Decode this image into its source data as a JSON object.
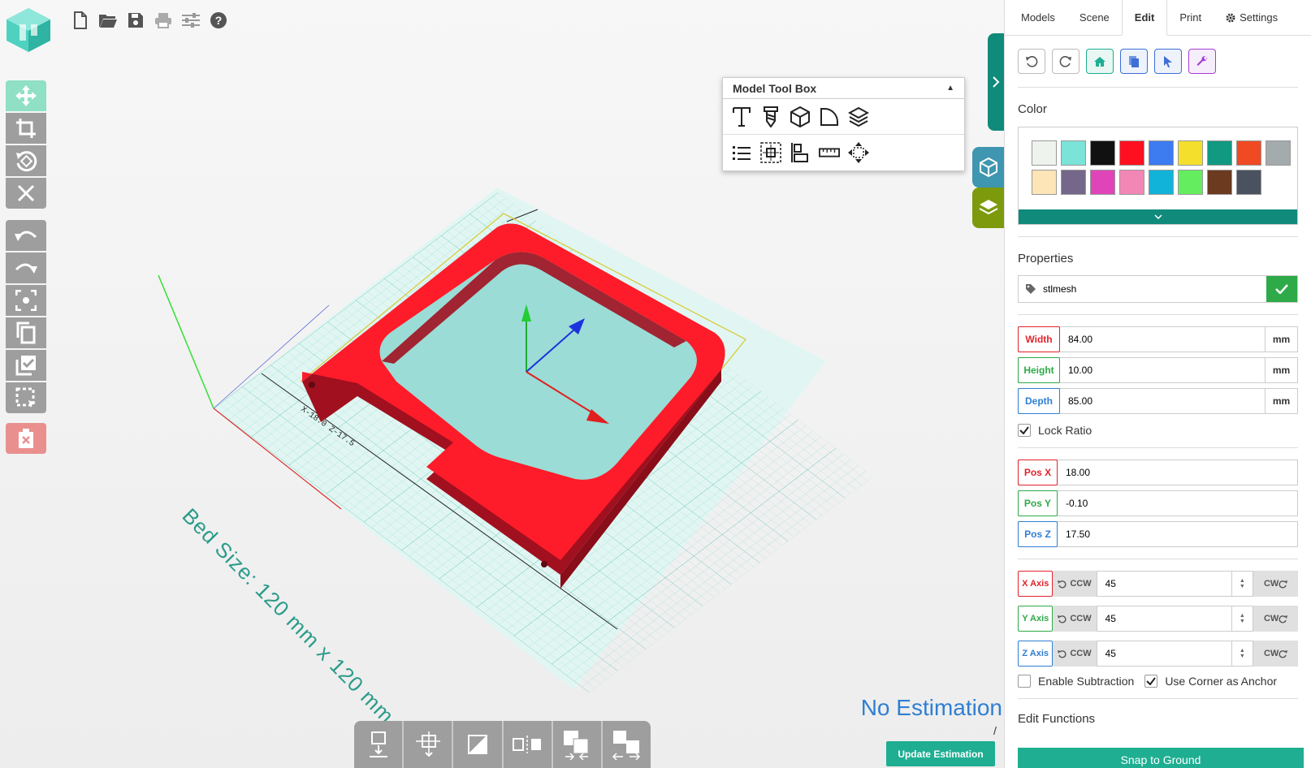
{
  "app": {
    "name": "3D printing slicer"
  },
  "topbar": {
    "items": [
      "new-file-icon",
      "open-folder-icon",
      "save-icon",
      "print-icon",
      "sliders-icon",
      "help-icon"
    ]
  },
  "viewport": {
    "bed_label": "Bed Size: 120 mm x 120 mm",
    "coord_label": "X-18.0 Z-17.5",
    "no_estimation": "No Estimation",
    "slash": "/",
    "update_button": "Update Estimation"
  },
  "toolbox": {
    "title": "Model Tool Box"
  },
  "tabs": {
    "models": "Models",
    "scene": "Scene",
    "edit": "Edit",
    "print": "Print",
    "settings": "Settings"
  },
  "color": {
    "label": "Color",
    "swatches": [
      "#eef3ee",
      "#7be3d8",
      "#111111",
      "#ff1020",
      "#3d7bf0",
      "#f4df2c",
      "#119981",
      "#ef4a23",
      "#a3abac",
      "#fde5b8",
      "#75678a",
      "#df45b8",
      "#f287b6",
      "#11b3d9",
      "#64ed5e",
      "#6b3a1f",
      "#4a5260"
    ]
  },
  "properties": {
    "label": "Properties",
    "name": "stlmesh"
  },
  "dimensions": {
    "width": {
      "label": "Width",
      "value": "84.00",
      "unit": "mm"
    },
    "height": {
      "label": "Height",
      "value": "10.00",
      "unit": "mm"
    },
    "depth": {
      "label": "Depth",
      "value": "85.00",
      "unit": "mm"
    },
    "lock_ratio": "Lock Ratio"
  },
  "position": {
    "x": {
      "label": "Pos X",
      "value": "18.00"
    },
    "y": {
      "label": "Pos Y",
      "value": "-0.10"
    },
    "z": {
      "label": "Pos Z",
      "value": "17.50"
    }
  },
  "rotation": {
    "ccw": "CCW",
    "cw": "CW",
    "x": {
      "label": "X Axis",
      "value": "45"
    },
    "y": {
      "label": "Y Axis",
      "value": "45"
    },
    "z": {
      "label": "Z Axis",
      "value": "45"
    }
  },
  "options": {
    "enable_subtraction": "Enable Subtraction",
    "use_corner_anchor": "Use Corner as Anchor"
  },
  "edit_functions": {
    "label": "Edit Functions",
    "snap_to_ground": "Snap to Ground"
  },
  "colors": {
    "accent": "#108a7a",
    "red": "#e0242c",
    "green": "#2eaa48",
    "blue": "#2f7fd2"
  }
}
